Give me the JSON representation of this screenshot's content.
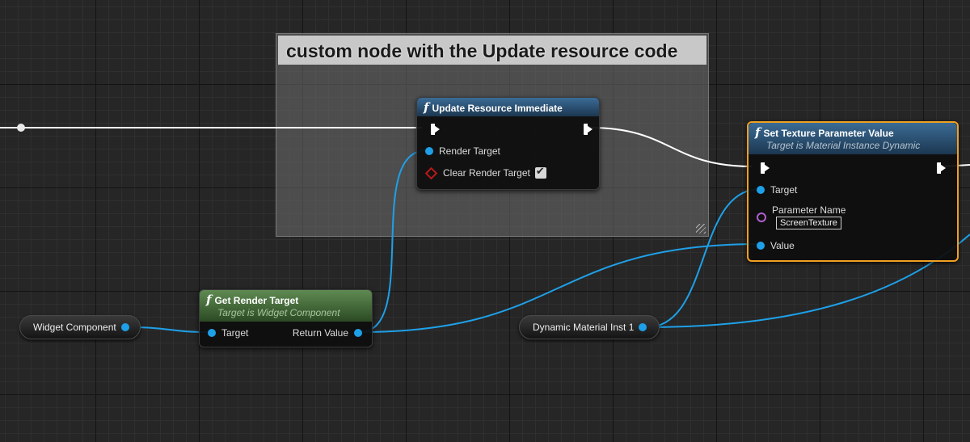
{
  "comment": {
    "title": "custom node with the Update resource code"
  },
  "nodes": {
    "update_resource": {
      "icon": "function-icon",
      "title": "Update Resource Immediate",
      "pins": {
        "render_target": "Render Target",
        "clear_render_target": "Clear Render Target"
      },
      "clear_render_target_checked": true
    },
    "set_texture_param": {
      "icon": "function-icon",
      "title": "Set Texture Parameter Value",
      "subtitle": "Target is Material Instance Dynamic",
      "pins": {
        "target": "Target",
        "parameter_name": "Parameter Name",
        "value": "Value"
      },
      "parameter_name_value": "ScreenTexture"
    },
    "get_render_target": {
      "icon": "function-icon",
      "title": "Get Render Target",
      "subtitle": "Target is Widget Component",
      "pins": {
        "target": "Target",
        "return_value": "Return Value"
      }
    },
    "widget_component": {
      "label": "Widget Component"
    },
    "dynamic_material": {
      "label": "Dynamic Material Inst 1"
    }
  },
  "colors": {
    "object_pin": "#1ea0e8",
    "exec_wire": "#ffffff",
    "selection": "#f0a020",
    "bool_pin": "#b81a1a",
    "name_pin": "#b060d0"
  }
}
